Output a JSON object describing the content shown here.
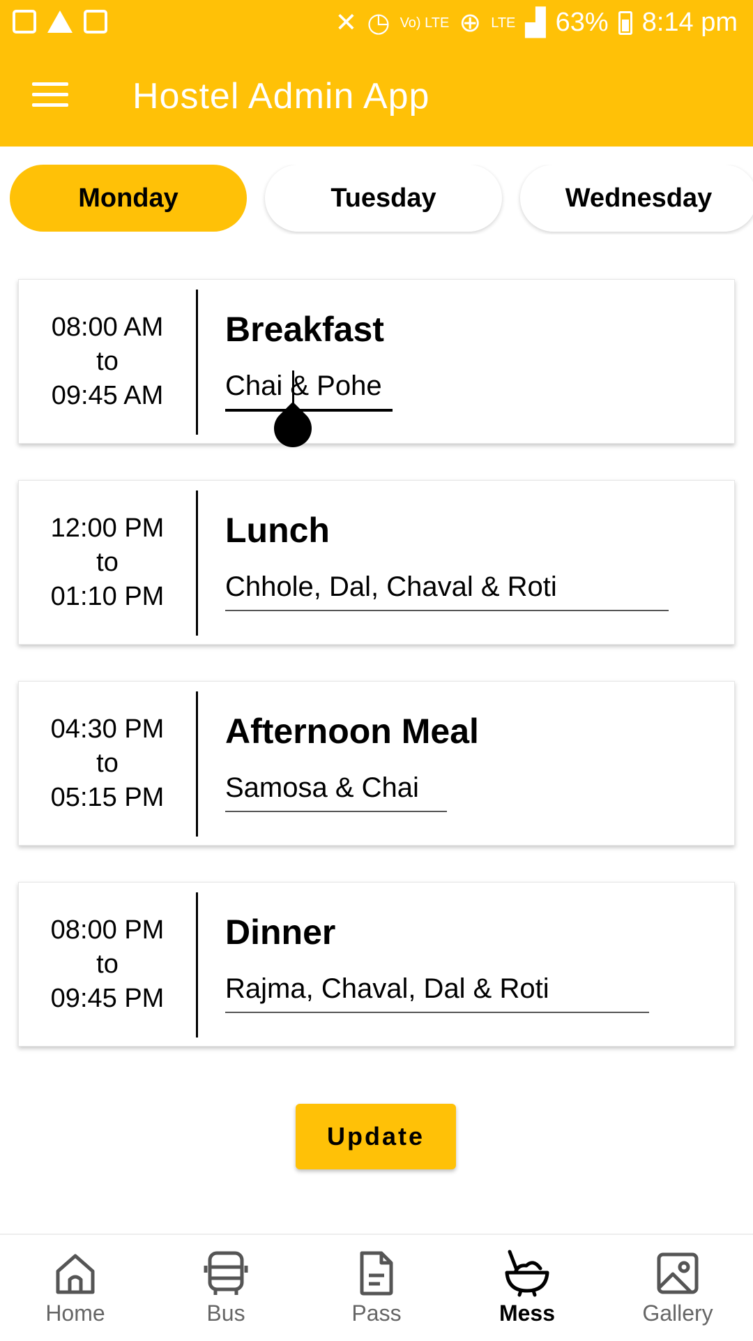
{
  "status_bar": {
    "left_icons": [
      "image-icon",
      "warning-icon",
      "wifi-icon"
    ],
    "right_icons": [
      "mute-icon",
      "alarm-icon",
      "volte-icon",
      "globe-icon",
      "lte-icon",
      "signal-icon"
    ],
    "volte_label": "Vo) LTE",
    "lte_label": "LTE",
    "battery": "63%",
    "time": "8:14 pm"
  },
  "app_bar": {
    "title": "Hostel Admin App",
    "menu_icon": "hamburger-menu-icon"
  },
  "day_tabs": [
    {
      "label": "Monday",
      "active": true
    },
    {
      "label": "Tuesday",
      "active": false
    },
    {
      "label": "Wednesday",
      "active": false
    }
  ],
  "meals": [
    {
      "start": "08:00 AM",
      "to": "to",
      "end": "09:45 AM",
      "title": "Breakfast",
      "menu": "Chai & Pohe",
      "focused": true
    },
    {
      "start": "12:00 PM",
      "to": "to",
      "end": "01:10 PM",
      "title": "Lunch",
      "menu": "Chhole, Dal, Chaval & Roti",
      "focused": false
    },
    {
      "start": "04:30 PM",
      "to": "to",
      "end": "05:15 PM",
      "title": "Afternoon Meal",
      "menu": "Samosa & Chai",
      "focused": false
    },
    {
      "start": "08:00 PM",
      "to": "to",
      "end": "09:45 PM",
      "title": "Dinner",
      "menu": "Rajma, Chaval, Dal & Roti",
      "focused": false
    }
  ],
  "update_button": {
    "label": "Update"
  },
  "bottom_nav": [
    {
      "label": "Home",
      "icon": "home-icon",
      "active": false
    },
    {
      "label": "Bus",
      "icon": "bus-icon",
      "active": false
    },
    {
      "label": "Pass",
      "icon": "document-icon",
      "active": false
    },
    {
      "label": "Mess",
      "icon": "food-bowl-icon",
      "active": true
    },
    {
      "label": "Gallery",
      "icon": "gallery-icon",
      "active": false
    }
  ],
  "colors": {
    "accent": "#FFC107",
    "text": "#000000",
    "inactive_nav": "#666666"
  }
}
